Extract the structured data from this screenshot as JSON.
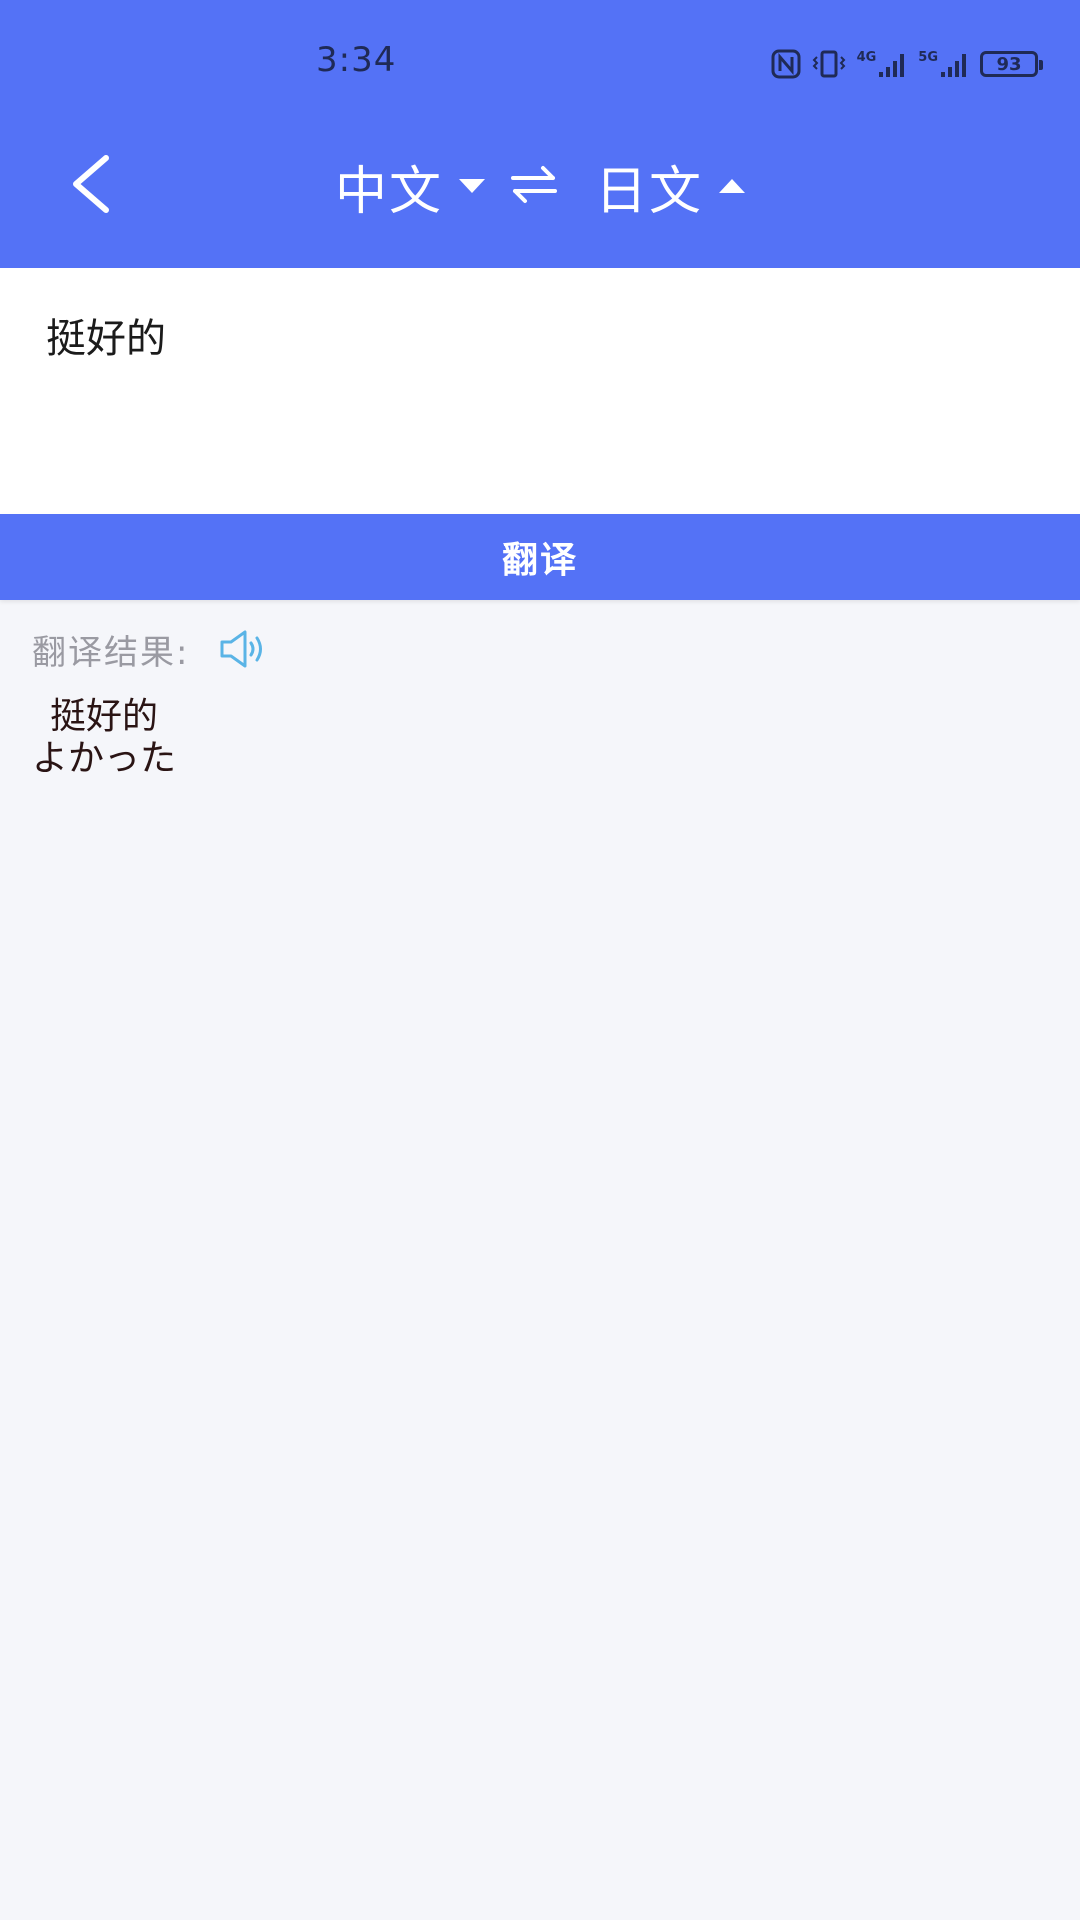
{
  "status_bar": {
    "time": "3:34",
    "network_4g": "4G",
    "network_5g": "5G",
    "battery": "93",
    "icons": [
      "nfc-icon",
      "vibrate-icon",
      "signal-4g-icon",
      "signal-5g-icon",
      "battery-icon"
    ]
  },
  "header": {
    "source_lang": "中文",
    "target_lang": "日文",
    "icons": [
      "back-arrow-icon",
      "caret-down-icon",
      "swap-icon",
      "caret-up-icon"
    ]
  },
  "input": {
    "text": "挺好的"
  },
  "translate_button": {
    "label": "翻译"
  },
  "result": {
    "label": "翻译结果:",
    "source_line": "挺好的",
    "translated_line": "よかった",
    "icon": "speaker-icon"
  },
  "colors": {
    "primary": "#5472f6",
    "background": "#f5f6fa",
    "speaker": "#5ab4e6"
  }
}
